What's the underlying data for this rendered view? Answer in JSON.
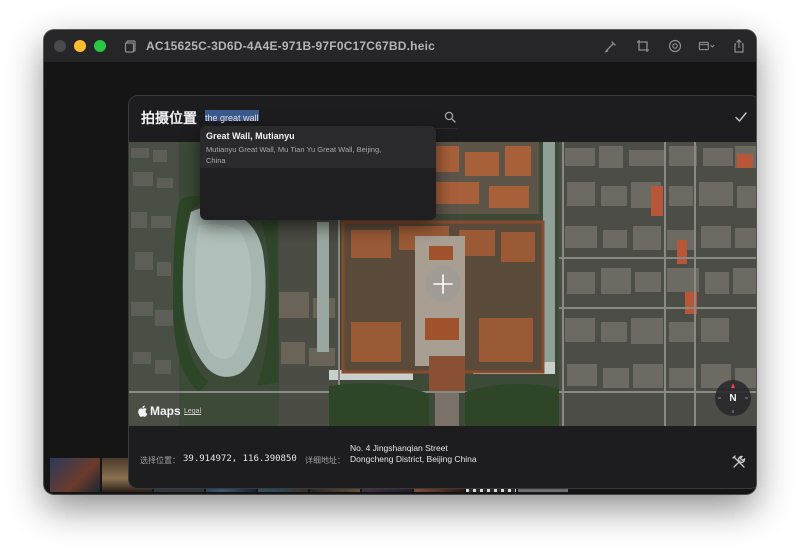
{
  "window": {
    "title": "AC15625C-3D6D-4A4E-971B-97F0C17C67BD.heic",
    "toolbar_icons": [
      "markup-icon",
      "crop-icon",
      "adjust-icon",
      "share-menu-icon",
      "share-icon"
    ]
  },
  "dialog": {
    "title": "拍摄位置",
    "search": {
      "value": "the great wall",
      "icon": "search-icon"
    },
    "confirm_icon": "checkmark-icon",
    "suggestions": [
      {
        "title": "Great Wall, Mutianyu",
        "subtitle": "Mutianyu Great Wall, Mu Tian Yu Great Wall, Beijing, China"
      }
    ],
    "map": {
      "attribution_logo": "Maps",
      "legal_label": "Legal",
      "compass_label": "N"
    },
    "footer": {
      "selected_label": "选择位置：",
      "coordinates": "39.914972, 116.390850",
      "address_label": "详细地址：",
      "address": "No. 4 Jingshanqian Street Dongcheng District, Beijing China"
    }
  },
  "colors": {
    "window_bg": "#1c1c1e",
    "dialog_bg": "#1d1d1f",
    "selection_highlight": "#3c5a8c",
    "map_roof": "#b8643a",
    "lake": "#aebcb8",
    "vegetation": "#2f4a2a"
  }
}
